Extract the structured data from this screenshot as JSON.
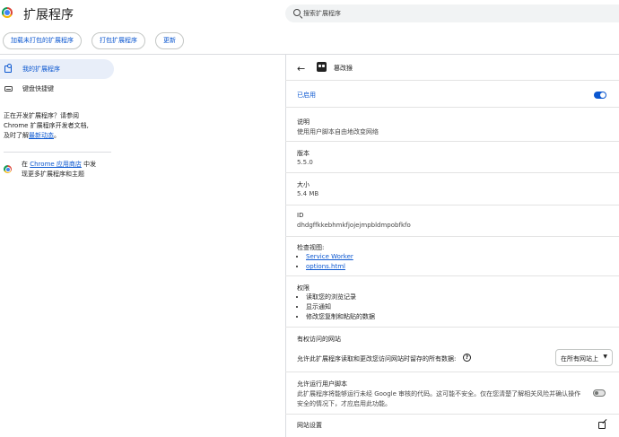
{
  "header": {
    "title": "扩展程序",
    "search_placeholder": "搜索扩展程序"
  },
  "toolbar": {
    "load_unpacked": "加载未打包的扩展程序",
    "pack": "打包扩展程序",
    "update": "更新"
  },
  "sidebar": {
    "items": [
      {
        "label": "我的扩展程序",
        "icon": "puzzle-icon",
        "active": true
      },
      {
        "label": "键盘快捷键",
        "icon": "keyboard-icon",
        "active": false
      }
    ],
    "dev_text_line1": "正在开发扩展程序？请参阅",
    "dev_text_line2": "Chrome 扩展程序开发者文档,",
    "dev_text_line3_prefix": "及时了解",
    "dev_text_link": "最新动态",
    "dev_text_suffix": "。",
    "store_prefix": "在 ",
    "store_link": "Chrome 应用商店",
    "store_suffix": " 中发",
    "store_line2": "现更多扩展程序和主题"
  },
  "detail": {
    "extension_name": "篡改猴",
    "enabled_label": "已启用",
    "enabled": true,
    "description_label": "说明",
    "description_value": "使用用户脚本自由地改变网络",
    "version_label": "版本",
    "version_value": "5.5.0",
    "size_label": "大小",
    "size_value": "5.4 MB",
    "id_label": "ID",
    "id_value": "dhdgffkkebhmkfjojejmpbldmpobfkfo",
    "inspect_label": "检查视图:",
    "inspect_links": [
      "Service Worker",
      "options.html"
    ],
    "permissions_label": "权限",
    "permissions": [
      "读取您的浏览记录",
      "显示通知",
      "修改您复制和粘贴的数据"
    ],
    "site_access_label": "有权访问的网站",
    "site_access_desc": "允许此扩展程序读取和更改您访问网站时留存的所有数据:",
    "site_access_value": "在所有网站上",
    "user_scripts_label": "允许运行用户脚本",
    "user_scripts_desc": "此扩展程序将能够运行未经 Google 审核的代码。这可能不安全。仅在您清楚了解相关风险并确认操作安全的情况下，才应启用此功能。",
    "user_scripts_enabled": false,
    "site_settings_label": "网站设置"
  },
  "colors": {
    "accent": "#0b57d0",
    "active_nav_bg": "#e8eef9"
  }
}
